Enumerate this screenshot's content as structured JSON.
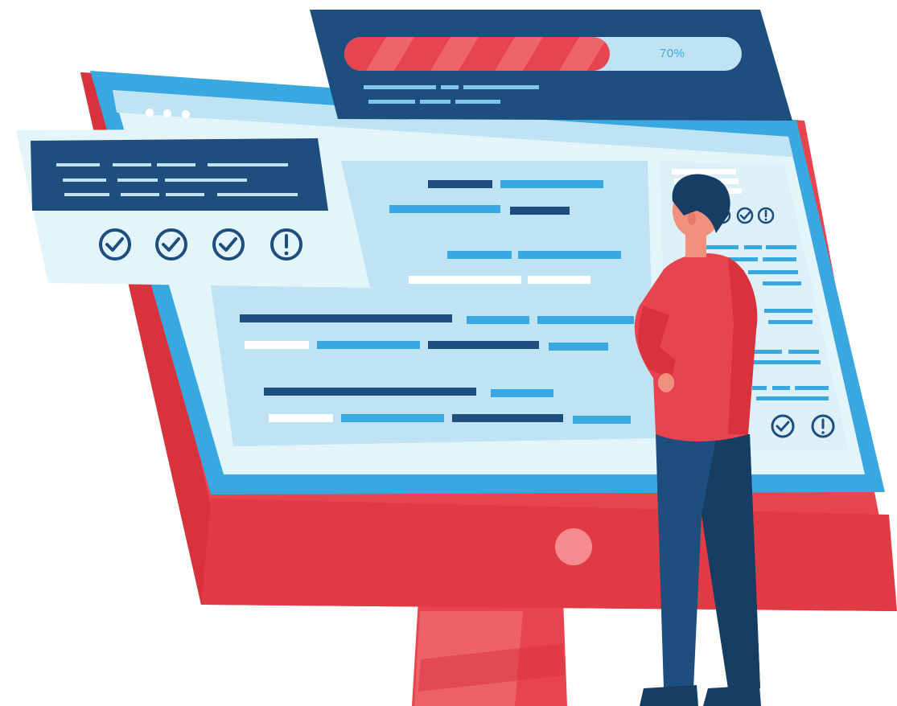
{
  "illustration": {
    "progress": {
      "label": "70%",
      "value": 0.7
    },
    "status_icons": {
      "top_panel": [
        "check-icon",
        "check-icon",
        "check-icon",
        "alert-icon"
      ],
      "side_panel_upper": [
        "check-icon",
        "check-icon",
        "alert-icon"
      ],
      "side_panel_lower": [
        "check-icon",
        "alert-icon"
      ]
    },
    "colors": {
      "navy": "#1d4e7e",
      "blue": "#3aa8e0",
      "light_blue": "#bfe3f3",
      "red": "#e8444f",
      "pink": "#f07a80",
      "panel": "#dcf0f8"
    }
  }
}
